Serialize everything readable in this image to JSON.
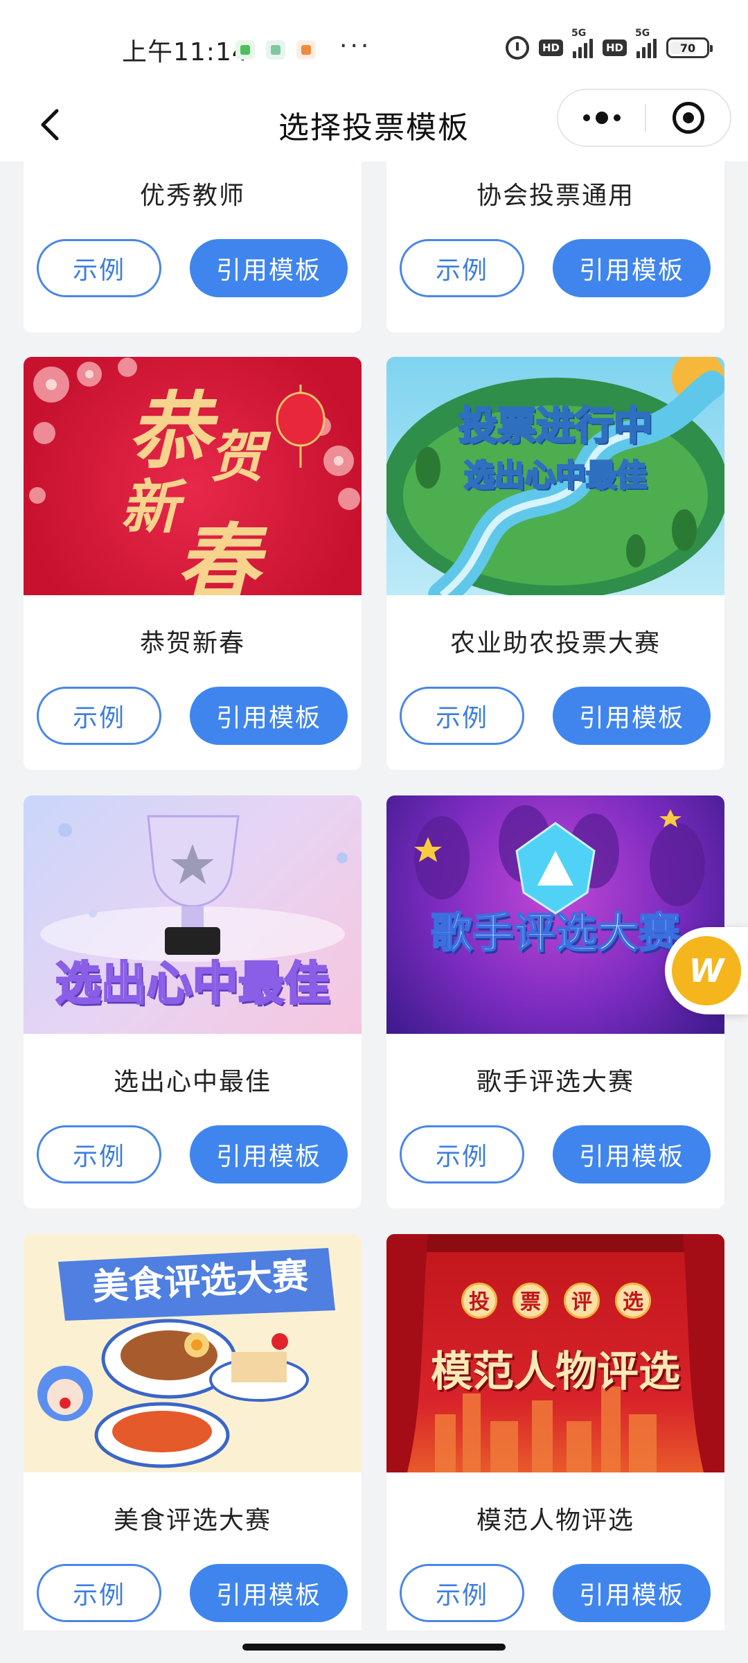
{
  "status_bar": {
    "time": "上午11:14",
    "dots": "···",
    "network_1": "5G",
    "network_2": "5G",
    "hd_1": "HD",
    "hd_2": "HD",
    "battery": "70",
    "icons": [
      "alarm-icon",
      "hd-badge",
      "signal-icon",
      "battery-icon"
    ]
  },
  "nav": {
    "title": "选择投票模板",
    "back_icon": "chevron-left-icon",
    "more_icon": "more-dots-icon",
    "close_icon": "target-icon"
  },
  "buttons": {
    "example_label": "示例",
    "use_label": "引用模板"
  },
  "templates": [
    {
      "title": "优秀教师",
      "image_text": ""
    },
    {
      "title": "协会投票通用",
      "image_text": ""
    },
    {
      "title": "恭贺新春",
      "image_text": [
        "恭",
        "贺",
        "新",
        "春"
      ]
    },
    {
      "title": "农业助农投票大赛",
      "image_text": [
        "投票进行中",
        "选出心中最佳"
      ]
    },
    {
      "title": "选出心中最佳",
      "image_text": [
        "选出心中最佳"
      ]
    },
    {
      "title": "歌手评选大赛",
      "image_text": [
        "歌手评选大赛"
      ]
    },
    {
      "title": "美食评选大赛",
      "image_text": [
        "美食评选大赛"
      ]
    },
    {
      "title": "模范人物评选",
      "image_text": [
        "投",
        "票",
        "评",
        "选",
        "模范人物评选"
      ]
    }
  ],
  "colors": {
    "primary": "#3f85ed",
    "outline": "#4a86e8",
    "background": "#f2f3f5",
    "float_accent": "#f5b51c"
  }
}
